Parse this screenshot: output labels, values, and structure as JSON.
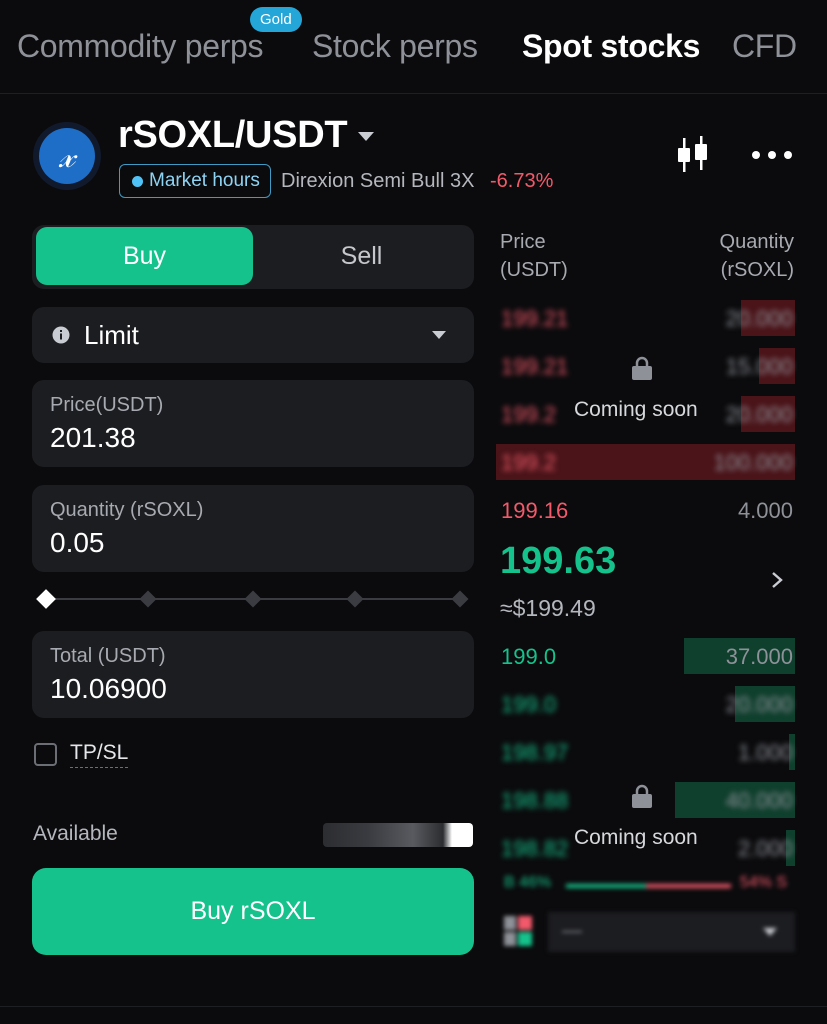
{
  "tabs": {
    "commodity": "Commodity perps",
    "gold_badge": "Gold",
    "stock": "Stock perps",
    "spot": "Spot stocks",
    "cfd": "CFD"
  },
  "header": {
    "logo_letter": "X",
    "pair": "rSOXL/USDT",
    "market_badge": "Market hours",
    "name": "Direxion Semi Bull 3X",
    "change": "-6.73%"
  },
  "trade": {
    "buy_tab": "Buy",
    "sell_tab": "Sell",
    "order_type": "Limit",
    "price_label": "Price(USDT)",
    "price_value": "201.38",
    "qty_label": "Quantity (rSOXL)",
    "qty_value": "0.05",
    "total_label": "Total (USDT)",
    "total_value": "10.06900",
    "tpsl_label": "TP/SL",
    "available_label": "Available",
    "buy_button": "Buy rSOXL"
  },
  "orderbook": {
    "price_header": "Price\n(USDT)",
    "qty_header": "Quantity\n(rSOXL)",
    "asks": [
      {
        "price": "199.21",
        "qty": "20.000",
        "depth": 0.18
      },
      {
        "price": "199.21",
        "qty": "15.000",
        "depth": 0.12
      },
      {
        "price": "199.2",
        "qty": "20.000",
        "depth": 0.18
      },
      {
        "price": "199.2",
        "qty": "100.000",
        "depth": 1.0
      },
      {
        "price": "199.16",
        "qty": "4.000",
        "depth": 0.0
      }
    ],
    "mid_price": "199.63",
    "mid_usd": "≈$199.49",
    "bids": [
      {
        "price": "199.0",
        "qty": "37.000",
        "depth": 0.37
      },
      {
        "price": "199.0",
        "qty": "20.000",
        "depth": 0.2
      },
      {
        "price": "198.97",
        "qty": "1.000",
        "depth": 0.02
      },
      {
        "price": "198.88",
        "qty": "40.000",
        "depth": 0.4
      },
      {
        "price": "198.82",
        "qty": "2.000",
        "depth": 0.03
      }
    ],
    "coming_soon": "Coming soon",
    "ratio_bid": "B 46%",
    "ratio_ask": "54% S",
    "depth_value": "—"
  },
  "colors": {
    "accent_green": "#16c28c",
    "ask_red": "#f25a6b",
    "badge_blue": "#25a6d8"
  }
}
